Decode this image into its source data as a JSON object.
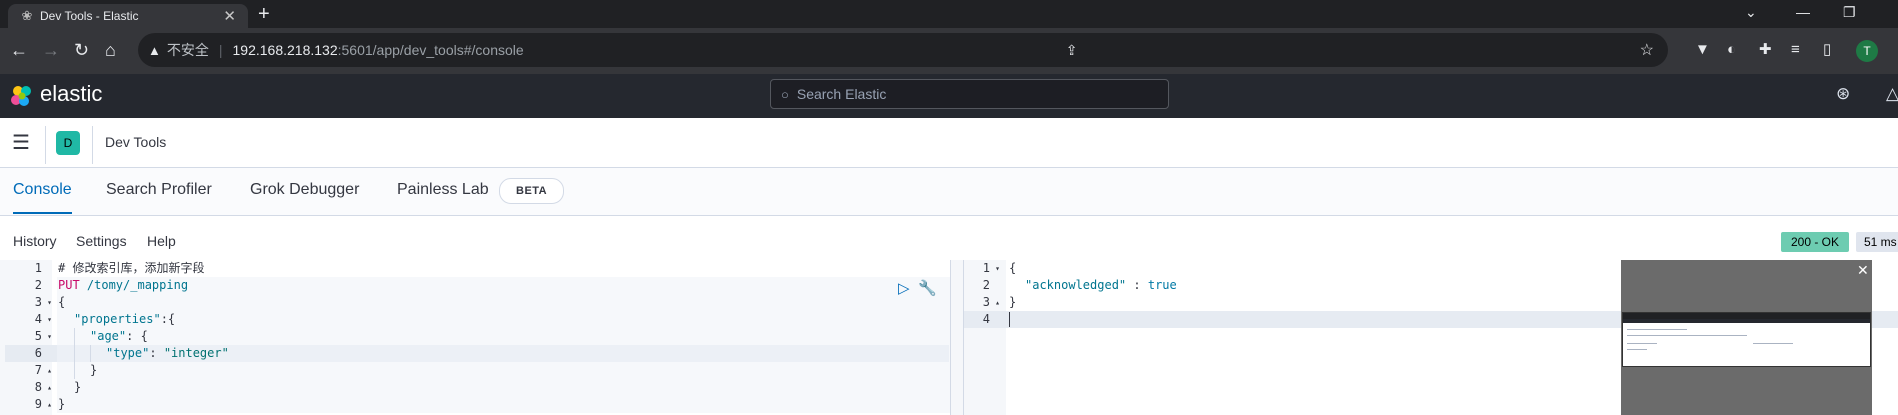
{
  "browser": {
    "tab_title": "Dev Tools - Elastic",
    "new_tab": "+",
    "insecure_label": "不安全",
    "url_host": "192.168.218.132",
    "url_path": ":5601/app/dev_tools#/console",
    "profile_initial": "T"
  },
  "kibana": {
    "brand": "elastic",
    "search_placeholder": "Search Elastic",
    "space_initial": "D",
    "breadcrumb": "Dev Tools"
  },
  "tabs": [
    {
      "label": "Console",
      "active": true
    },
    {
      "label": "Search Profiler",
      "active": false
    },
    {
      "label": "Grok Debugger",
      "active": false
    },
    {
      "label": "Painless Lab",
      "active": false
    }
  ],
  "beta_badge": "BETA",
  "menu": {
    "history": "History",
    "settings": "Settings",
    "help": "Help"
  },
  "response_status": {
    "code": "200 - OK",
    "time": "51 ms"
  },
  "request_editor": {
    "line_numbers": [
      "1",
      "2",
      "3",
      "4",
      "5",
      "6",
      "7",
      "8",
      "9"
    ],
    "fold_markers": [
      "",
      "",
      "▾",
      "▾",
      "▾",
      "",
      "▴",
      "▴",
      "▴"
    ],
    "active_line": 6,
    "lines": {
      "l1": "# 修改索引库，添加新字段",
      "l2_method": "PUT",
      "l2_url": " /tomy/_mapping",
      "l3": "{",
      "l4_key": "\"properties\"",
      "l4_rest": ":{",
      "l5_key": "\"age\"",
      "l5_rest": ": {",
      "l6_key": "\"type\"",
      "l6_sep": ": ",
      "l6_val": "\"integer\"",
      "l7": "}",
      "l8": "}",
      "l9": "}"
    }
  },
  "response_editor": {
    "line_numbers": [
      "1",
      "2",
      "3",
      "4"
    ],
    "fold_markers": [
      "▾",
      "",
      "▴",
      ""
    ],
    "active_line": 4,
    "lines": {
      "l1": "{",
      "l2_key": "\"acknowledged\"",
      "l2_sep": " : ",
      "l2_val": "true",
      "l3": "}"
    }
  },
  "colors": {
    "accent": "#006bb8",
    "header_bg": "#25282f",
    "status_ok": "#6dccb1",
    "space_avatar": "#20b8a5"
  }
}
